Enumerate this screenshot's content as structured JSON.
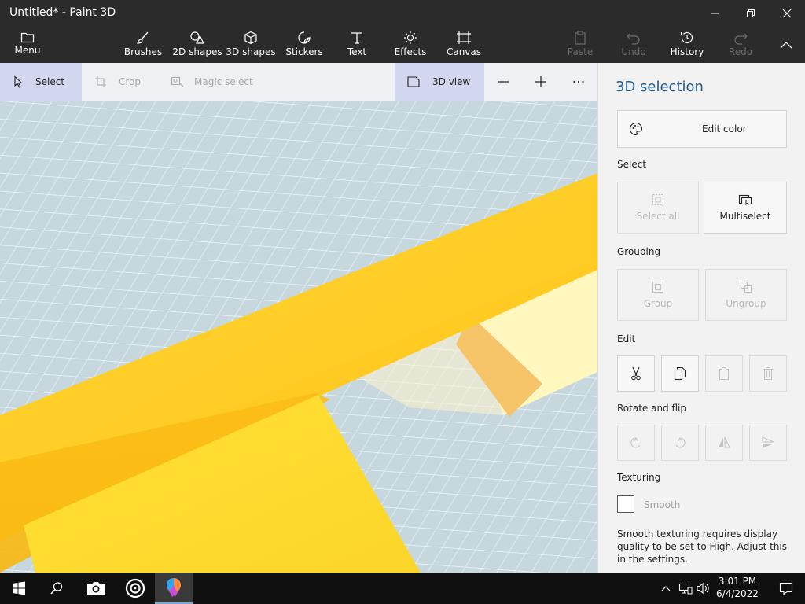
{
  "window": {
    "title": "Untitled* - Paint 3D",
    "min_icon": "minimize-icon",
    "max_icon": "restore-icon",
    "close_icon": "close-icon"
  },
  "ribbon": {
    "menu": "Menu",
    "tools": [
      {
        "label": "Brushes",
        "icon": "brush-icon"
      },
      {
        "label": "2D shapes",
        "icon": "2d-shapes-icon"
      },
      {
        "label": "3D shapes",
        "icon": "cube-icon"
      },
      {
        "label": "Stickers",
        "icon": "sticker-icon"
      },
      {
        "label": "Text",
        "icon": "text-icon"
      },
      {
        "label": "Effects",
        "icon": "effects-icon"
      },
      {
        "label": "Canvas",
        "icon": "canvas-icon"
      }
    ],
    "paste": "Paste",
    "undo": "Undo",
    "history": "History",
    "redo": "Redo"
  },
  "toolbar": {
    "select": "Select",
    "crop": "Crop",
    "magic_select": "Magic select",
    "view_3d": "3D view"
  },
  "panel": {
    "title": "3D selection",
    "edit_color": "Edit color",
    "select_heading": "Select",
    "select_all": "Select all",
    "multiselect": "Multiselect",
    "grouping_heading": "Grouping",
    "group": "Group",
    "ungroup": "Ungroup",
    "edit_heading": "Edit",
    "rotate_heading": "Rotate and flip",
    "texturing_heading": "Texturing",
    "smooth": "Smooth",
    "smooth_note": "Smooth texturing requires display quality to be set to High. Adjust this in the settings."
  },
  "taskbar": {
    "time": "3:01 PM",
    "date": "6/4/2022"
  },
  "colors": {
    "accent": "#1f5c91",
    "dark": "#2b2b2b",
    "shape_yellow": "#ffd21e",
    "shape_light": "#fff6b8"
  }
}
